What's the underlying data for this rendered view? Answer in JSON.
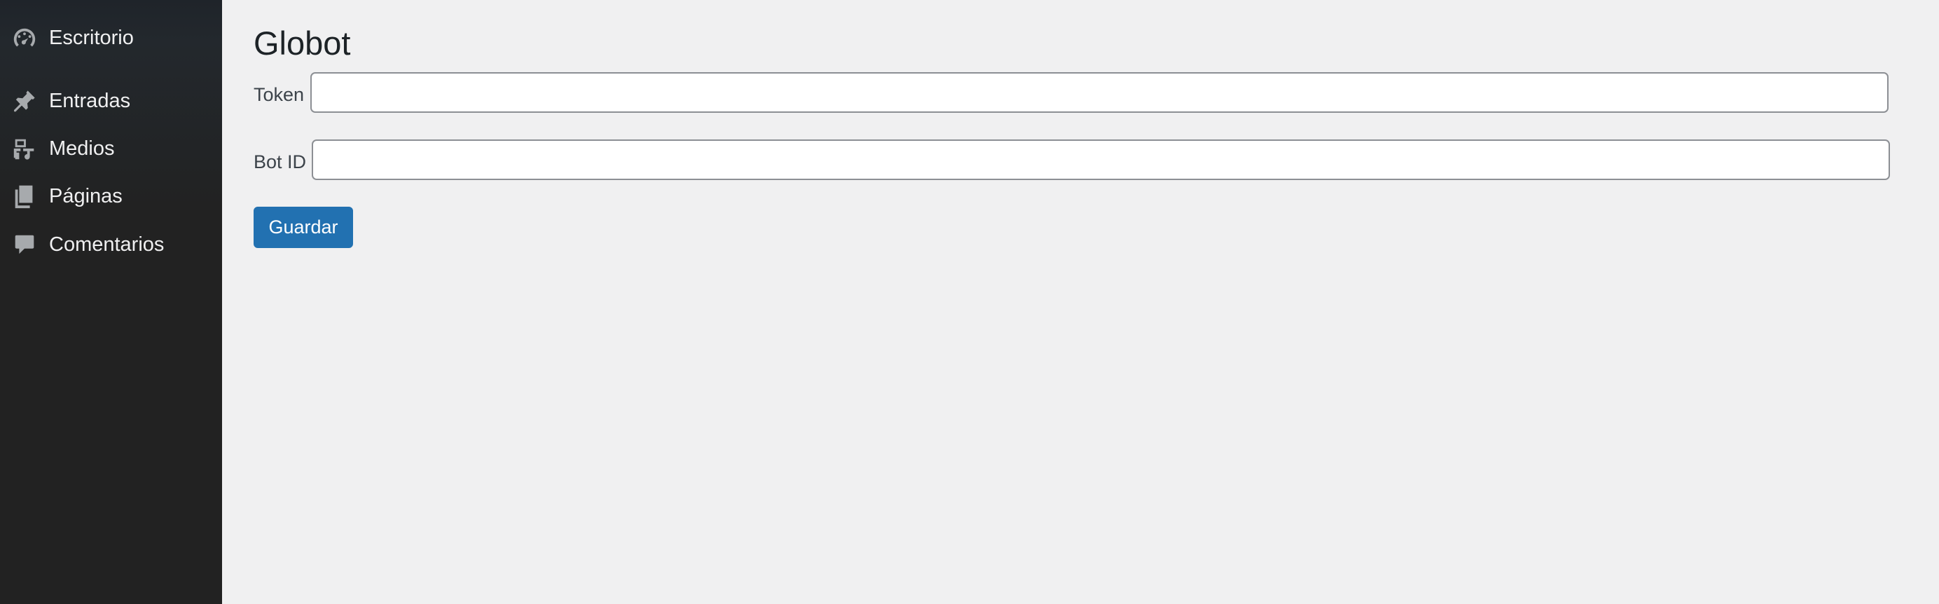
{
  "sidebar": {
    "items": [
      {
        "label": "Escritorio",
        "icon": "dashboard-icon"
      },
      {
        "label": "Entradas",
        "icon": "pin-icon"
      },
      {
        "label": "Medios",
        "icon": "media-icon"
      },
      {
        "label": "Páginas",
        "icon": "pages-icon"
      },
      {
        "label": "Comentarios",
        "icon": "comments-icon"
      }
    ]
  },
  "main": {
    "title": "Globot",
    "fields": [
      {
        "label": "Token",
        "value": ""
      },
      {
        "label": "Bot ID",
        "value": ""
      }
    ],
    "save_label": "Guardar"
  },
  "colors": {
    "sidebar_bg": "#23282d",
    "page_bg": "#f0f0f1",
    "primary_button": "#2271b1"
  }
}
